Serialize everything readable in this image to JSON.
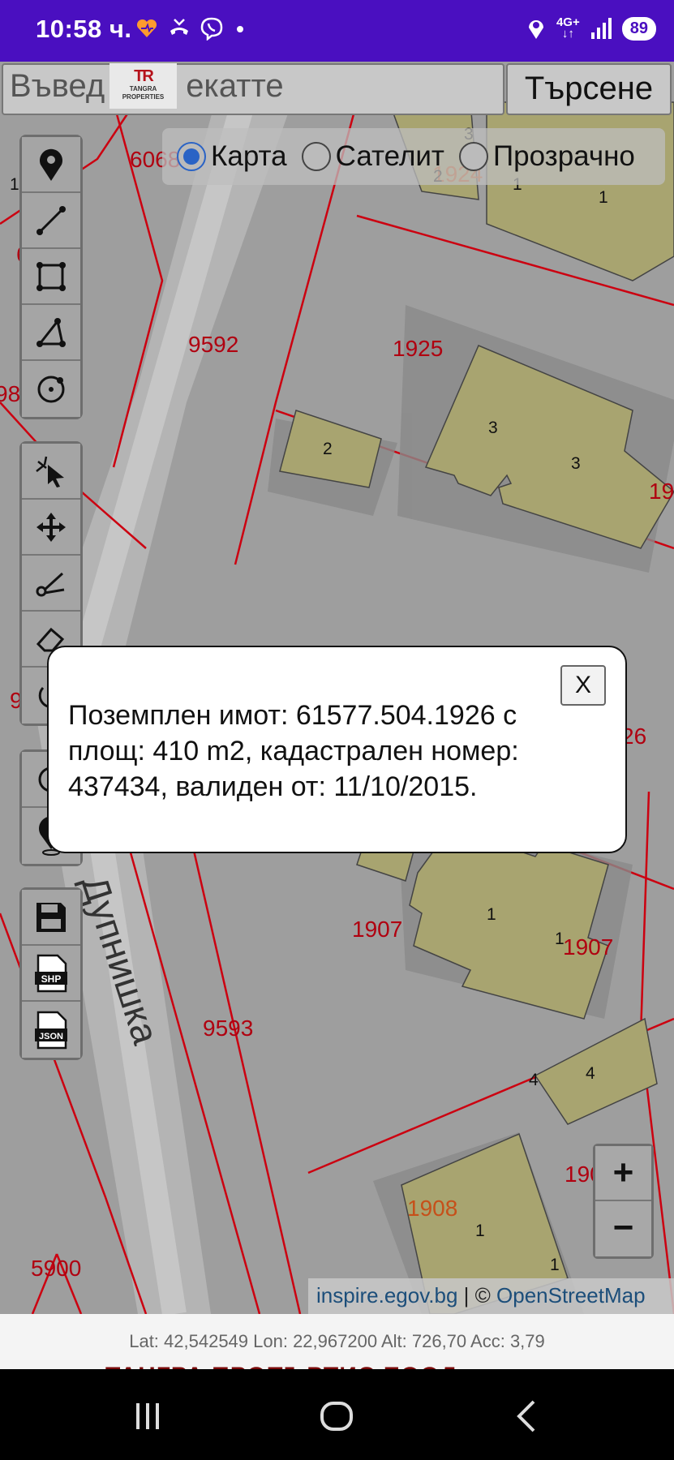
{
  "status_bar": {
    "time": "10:58 ч.",
    "network": "4G+",
    "battery": "89",
    "icons": [
      "heart-app-icon",
      "missed-call-icon",
      "viber-icon",
      "dot-icon",
      "location-icon",
      "signal-icon",
      "battery-icon"
    ]
  },
  "search": {
    "placeholder_left": "Въвед",
    "placeholder_right": "екатте",
    "button_label": "Търсене",
    "logo_mark": "TR",
    "logo_line1": "TANGRA",
    "logo_line2": "PROPERTIES"
  },
  "layers": {
    "options": [
      "Карта",
      "Сателит",
      "Прозрачно"
    ],
    "selected": "Карта"
  },
  "map": {
    "parcel_labels": [
      "6068",
      "1924",
      "9592",
      "1925",
      "9",
      "26",
      "1907",
      "1907",
      "9593",
      "1908",
      "190",
      "5900",
      "98",
      "19",
      "1",
      "6"
    ],
    "building_labels": [
      "3",
      "2",
      "1",
      "1",
      "3",
      "3",
      "2",
      "2",
      "1",
      "1",
      "4",
      "4",
      "1",
      "1"
    ],
    "street_name": "Дупнишка",
    "attribution_link1": "inspire.egov.bg",
    "attribution_sep": " | © ",
    "attribution_link2": "OpenStreetMap"
  },
  "toolbar_draw": [
    "location-pin-icon",
    "line-icon",
    "polygon-icon",
    "angle-icon",
    "circle-icon"
  ],
  "toolbar_edit": [
    "select-icon",
    "move-icon",
    "cut-icon",
    "erase-icon",
    "undo-icon"
  ],
  "toolbar_gps": [
    "gps-icon",
    "person-pin-icon"
  ],
  "toolbar_export": [
    "save-icon",
    "shp-export-icon",
    "json-export-icon"
  ],
  "export_labels": {
    "shp": "SHP",
    "json": "JSON"
  },
  "zoom": {
    "in": "+",
    "out": "−"
  },
  "modal": {
    "close_label": "X",
    "text": "Поземплен имот: 61577.504.1926 с площ: 410 m2, кадастрален номер: 437434, валиден от: 11/10/2015."
  },
  "gps_readout": "Lat: 42,542549 Lon: 22,967200 Alt: 726,70 Acc: 3,79",
  "footer_brand": "ТАНГРА ПРОПЪРТИС  ЕООД",
  "colors": {
    "status_bar": "#4a0fc0",
    "parcel_line": "#cc0010",
    "building_fill": "#a8a470",
    "accent_radio": "#2a63c5"
  }
}
